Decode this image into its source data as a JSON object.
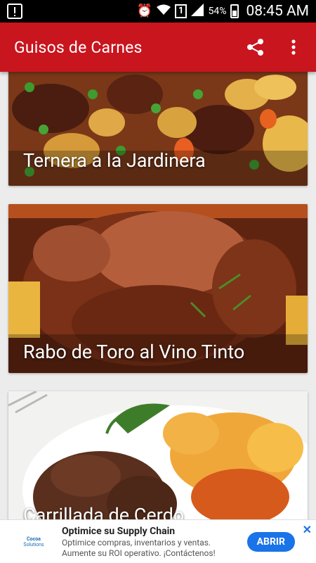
{
  "status_bar": {
    "battery_percent": "54%",
    "time": "08:45 AM",
    "sim_label": "1"
  },
  "app_bar": {
    "title": "Guisos de Carnes",
    "share_icon": "share-icon",
    "menu_icon": "overflow-menu-icon"
  },
  "recipes": [
    {
      "title": "Ternera a la Jardinera"
    },
    {
      "title": "Rabo de Toro al Vino Tinto"
    },
    {
      "title": "Carrillada de Cerdo"
    }
  ],
  "ad": {
    "logo_line1": "Cocoa",
    "logo_line2": "Solutions",
    "headline": "Optimice su Supply Chain",
    "body_line1": "Optimice compras, inventarios y ventas.",
    "body_line2": "Aumente su ROI operativo. ¡Contáctenos!",
    "cta": "ABRIR",
    "close": "✕"
  },
  "colors": {
    "app_bar": "#c9151e",
    "status_bar": "#000000",
    "background": "#ececec",
    "ad_cta": "#1a73e8"
  }
}
